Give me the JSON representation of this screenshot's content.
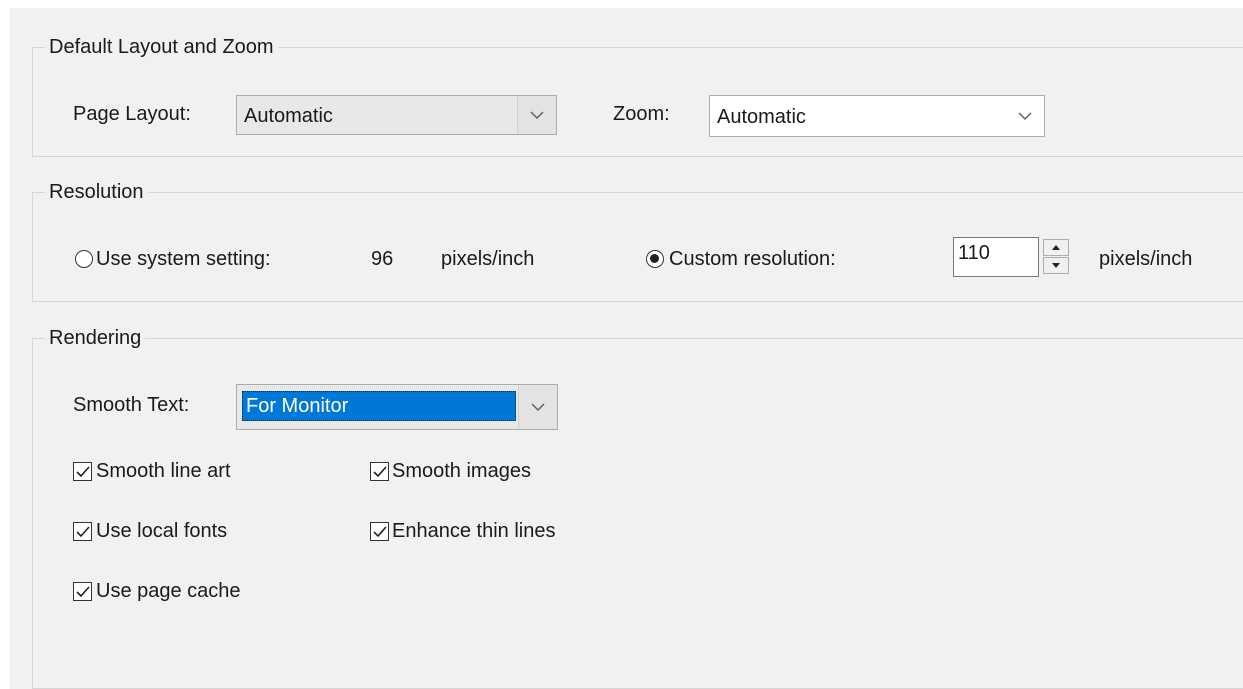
{
  "layout_zoom": {
    "title": "Default Layout and Zoom",
    "page_layout_label": "Page Layout:",
    "page_layout_value": "Automatic",
    "zoom_label": "Zoom:",
    "zoom_value": "Automatic"
  },
  "resolution": {
    "title": "Resolution",
    "system_setting_label": "Use system setting:",
    "system_value": "96",
    "system_unit": "pixels/inch",
    "system_selected": false,
    "custom_label": "Custom resolution:",
    "custom_value": "110",
    "custom_unit": "pixels/inch",
    "custom_selected": true
  },
  "rendering": {
    "title": "Rendering",
    "smooth_text_label": "Smooth Text:",
    "smooth_text_value": "For Monitor",
    "checkboxes": [
      {
        "label": "Smooth line art",
        "checked": true
      },
      {
        "label": "Smooth images",
        "checked": true
      },
      {
        "label": "Use local fonts",
        "checked": true
      },
      {
        "label": "Enhance thin lines",
        "checked": true
      },
      {
        "label": "Use page cache",
        "checked": true
      }
    ]
  },
  "icons": {
    "dropdown": "chevron-down-icon",
    "spin_up": "arrow-up-icon",
    "spin_down": "arrow-down-icon",
    "check": "checkmark-icon"
  },
  "colors": {
    "panel_bg": "#f1f1f1",
    "selection": "#0078d7",
    "border": "#d6d6d6"
  }
}
